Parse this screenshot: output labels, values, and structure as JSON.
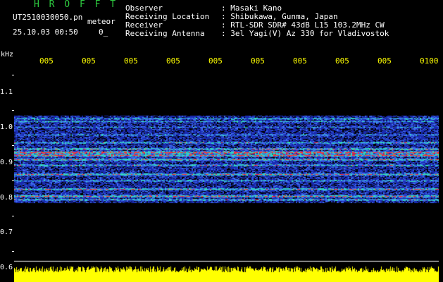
{
  "header": {
    "brand": "H R O F F T",
    "filename": "UT2510030050.pn",
    "filename_suffix": "meteor",
    "datetime": "25.10.03 00:50",
    "status": "0_"
  },
  "info": [
    {
      "label": "Observer",
      "value": "Masaki Kano"
    },
    {
      "label": "Receiving Location",
      "value": "Shibukawa, Gunma, Japan"
    },
    {
      "label": "Receiver",
      "value": "RTL-SDR SDR# 43dB L15 103.2MHz CW"
    },
    {
      "label": "Receiving Antenna",
      "value": "3el Yagi(V) Az 330 for Vladivostok"
    }
  ],
  "axis": {
    "y_unit": "kHz",
    "x_ticks": [
      "005",
      "005",
      "005",
      "005",
      "005",
      "005",
      "005",
      "005",
      "005",
      "0100"
    ],
    "y_ticks": [
      "1.1",
      "1.0",
      "0.9",
      "0.8",
      "0.7",
      "0.6"
    ]
  },
  "colors": {
    "background": "#000000",
    "brand": "#2ecc40",
    "axis_labels": "#ffff00",
    "signal_low": "#1a2bb0",
    "signal_mid": "#33d6c0",
    "signal_high": "#ff3030",
    "noise_level_fill": "#ffff00"
  }
}
